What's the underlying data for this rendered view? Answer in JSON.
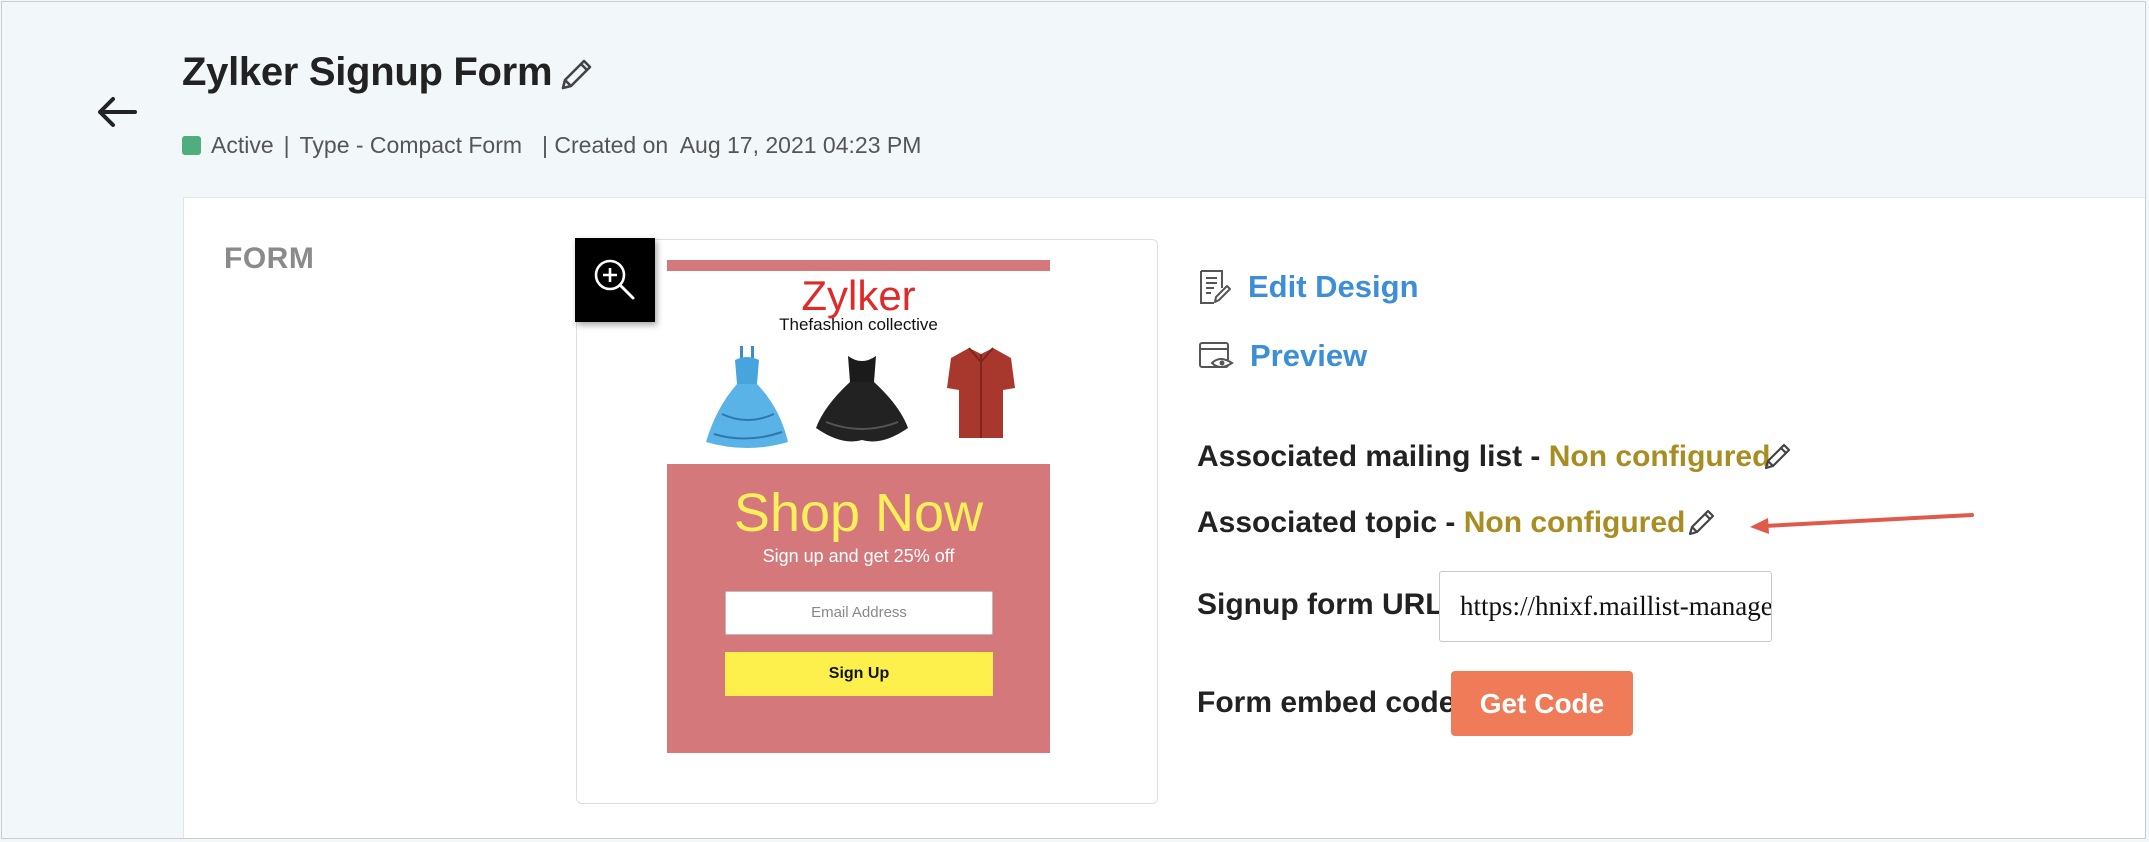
{
  "header": {
    "title": "Zylker Signup Form",
    "status": "Active",
    "type": "Type - Compact Form",
    "created": "| Created on  Aug 17, 2021 04:23 PM",
    "status_color": "#4fae7e"
  },
  "section": {
    "label": "FORM"
  },
  "preview": {
    "brand": "Zylker",
    "tagline": "Thefashion collective",
    "headline": "Shop Now",
    "offer": "Sign up and get 25% off",
    "email_placeholder": "Email Address",
    "signup_label": "Sign Up",
    "bg_color": "#d4787c",
    "accent_color": "#fdf05a"
  },
  "actions": {
    "edit_design": "Edit Design",
    "preview": "Preview",
    "link_color": "#3c8fd6"
  },
  "details": {
    "mailing_list_label": "Associated mailing list - ",
    "mailing_list_value": "Non configured",
    "topic_label": "Associated topic - ",
    "topic_value": "Non configured",
    "url_label": "Signup form URL",
    "url_value": "https://hnixf.maillist-manage.com",
    "embed_label": "Form embed code",
    "get_code_label": "Get Code",
    "get_code_color": "#ef7b58",
    "nonconfigured_color": "#a88e22",
    "annotation_color": "#e05a4a"
  }
}
